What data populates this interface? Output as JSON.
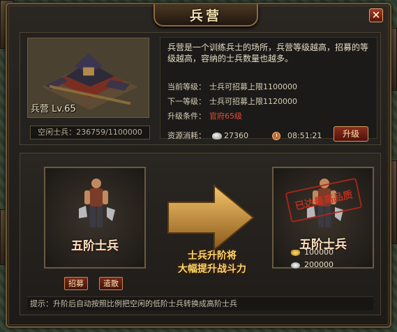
{
  "window": {
    "title": "兵营",
    "close_label": "×"
  },
  "building": {
    "name": "兵营 Lv.65",
    "idle_soldiers_label": "空闲士兵：236759/1100000"
  },
  "info": {
    "description": "兵营是一个训练兵士的场所，兵营等级越高，招募的等级越高，容纳的士兵数量也越多。",
    "current_label": "当前等级：",
    "current_value": "士兵可招募上限1100000",
    "next_label": "下一等级：",
    "next_value": "士兵可招募上限1120000",
    "condition_label": "升级条件：",
    "condition_value": "官府65级",
    "cost_label": "资源消耗：",
    "cost_silver": "27360",
    "cost_time": "08:51:21",
    "upgrade_label": "升级"
  },
  "upgrade": {
    "from_unit": "五阶士兵",
    "to_unit": "五阶士兵",
    "max_stamp": "已达最高品质",
    "slogan_line1": "士兵升阶将",
    "slogan_line2": "大幅提升战斗力",
    "recruit_label": "招募",
    "dismiss_label": "遣散",
    "cost_gold": "100000",
    "cost_silver": "200000",
    "tip": "提示：升阶后自动按照比例把空闲的低阶士兵转换成高阶士兵"
  },
  "colors": {
    "accent_red": "#e84a3a",
    "gold_text": "#f5d96b",
    "frame": "#6d5a3c"
  }
}
